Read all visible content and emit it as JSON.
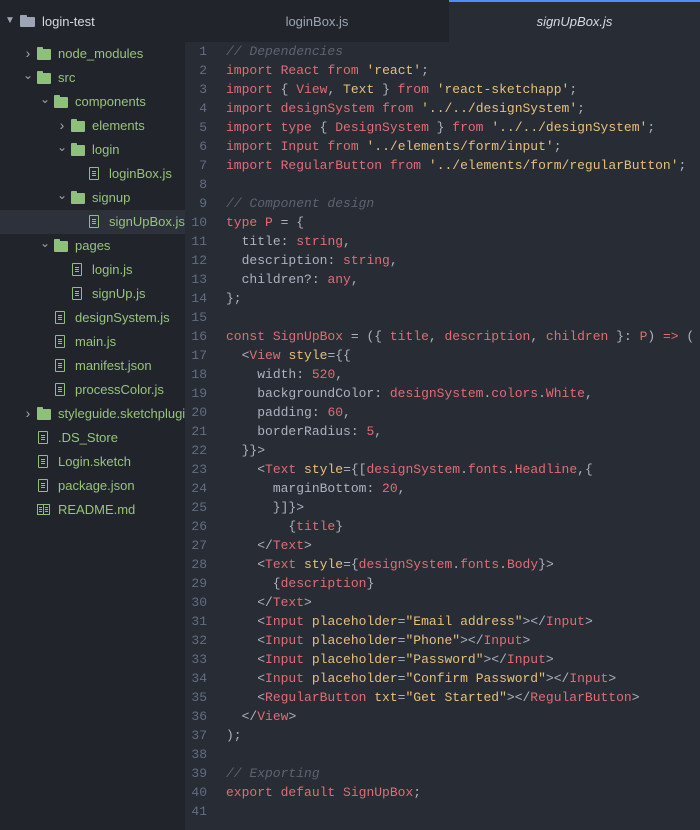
{
  "colors": {
    "sidebar_bg": "#21252b",
    "editor_bg": "#282c34",
    "tree_text": "#98c379",
    "active_tab_accent": "#528bff"
  },
  "project": {
    "name": "login-test",
    "expanded": true
  },
  "tree": [
    {
      "label": "node_modules",
      "kind": "folder",
      "depth": 1,
      "expanded": false
    },
    {
      "label": "src",
      "kind": "folder",
      "depth": 1,
      "expanded": true
    },
    {
      "label": "components",
      "kind": "folder",
      "depth": 2,
      "expanded": true
    },
    {
      "label": "elements",
      "kind": "folder",
      "depth": 3,
      "expanded": false
    },
    {
      "label": "login",
      "kind": "folder",
      "depth": 3,
      "expanded": true
    },
    {
      "label": "loginBox.js",
      "kind": "file",
      "depth": 4
    },
    {
      "label": "signup",
      "kind": "folder",
      "depth": 3,
      "expanded": true
    },
    {
      "label": "signUpBox.js",
      "kind": "file",
      "depth": 4,
      "selected": true
    },
    {
      "label": "pages",
      "kind": "folder",
      "depth": 2,
      "expanded": true
    },
    {
      "label": "login.js",
      "kind": "file",
      "depth": 3
    },
    {
      "label": "signUp.js",
      "kind": "file",
      "depth": 3
    },
    {
      "label": "designSystem.js",
      "kind": "file",
      "depth": 2
    },
    {
      "label": "main.js",
      "kind": "file",
      "depth": 2
    },
    {
      "label": "manifest.json",
      "kind": "file",
      "depth": 2
    },
    {
      "label": "processColor.js",
      "kind": "file",
      "depth": 2
    },
    {
      "label": "styleguide.sketchplugi",
      "kind": "folder",
      "depth": 1,
      "expanded": false
    },
    {
      "label": ".DS_Store",
      "kind": "file",
      "depth": 1
    },
    {
      "label": "Login.sketch",
      "kind": "file",
      "depth": 1
    },
    {
      "label": "package.json",
      "kind": "file",
      "depth": 1
    },
    {
      "label": "README.md",
      "kind": "book",
      "depth": 1
    }
  ],
  "tabs": [
    {
      "label": "loginBox.js",
      "active": false
    },
    {
      "label": "signUpBox.js",
      "active": true
    }
  ],
  "code": [
    {
      "n": "1",
      "t": [
        [
          "cm",
          "// Dependencies"
        ]
      ]
    },
    {
      "n": "2",
      "t": [
        [
          "kw",
          "import"
        ],
        [
          "txt",
          " "
        ],
        [
          "id",
          "React"
        ],
        [
          "txt",
          " "
        ],
        [
          "kw",
          "from"
        ],
        [
          "txt",
          " "
        ],
        [
          "str",
          "'react'"
        ],
        [
          "txt",
          ";"
        ]
      ]
    },
    {
      "n": "3",
      "t": [
        [
          "kw",
          "import"
        ],
        [
          "txt",
          " { "
        ],
        [
          "id",
          "View"
        ],
        [
          "txt",
          ", "
        ],
        [
          "cls",
          "Text"
        ],
        [
          "txt",
          " } "
        ],
        [
          "kw",
          "from"
        ],
        [
          "txt",
          " "
        ],
        [
          "str",
          "'react-sketchapp'"
        ],
        [
          "txt",
          ";"
        ]
      ]
    },
    {
      "n": "4",
      "t": [
        [
          "kw",
          "import"
        ],
        [
          "txt",
          " "
        ],
        [
          "id",
          "designSystem"
        ],
        [
          "txt",
          " "
        ],
        [
          "kw",
          "from"
        ],
        [
          "txt",
          " "
        ],
        [
          "str",
          "'../../designSystem'"
        ],
        [
          "txt",
          ";"
        ]
      ]
    },
    {
      "n": "5",
      "t": [
        [
          "kw",
          "import"
        ],
        [
          "txt",
          " "
        ],
        [
          "kw",
          "type"
        ],
        [
          "txt",
          " { "
        ],
        [
          "id",
          "DesignSystem"
        ],
        [
          "txt",
          " } "
        ],
        [
          "kw",
          "from"
        ],
        [
          "txt",
          " "
        ],
        [
          "str",
          "'../../designSystem'"
        ],
        [
          "txt",
          ";"
        ]
      ]
    },
    {
      "n": "6",
      "t": [
        [
          "kw",
          "import"
        ],
        [
          "txt",
          " "
        ],
        [
          "id",
          "Input"
        ],
        [
          "txt",
          " "
        ],
        [
          "kw",
          "from"
        ],
        [
          "txt",
          " "
        ],
        [
          "str",
          "'../elements/form/input'"
        ],
        [
          "txt",
          ";"
        ]
      ]
    },
    {
      "n": "7",
      "t": [
        [
          "kw",
          "import"
        ],
        [
          "txt",
          " "
        ],
        [
          "id",
          "RegularButton"
        ],
        [
          "txt",
          " "
        ],
        [
          "kw",
          "from"
        ],
        [
          "txt",
          " "
        ],
        [
          "str",
          "'../elements/form/regularButton'"
        ],
        [
          "txt",
          ";"
        ]
      ]
    },
    {
      "n": "8",
      "t": []
    },
    {
      "n": "9",
      "t": [
        [
          "cm",
          "// Component design"
        ]
      ]
    },
    {
      "n": "10",
      "t": [
        [
          "kw",
          "type"
        ],
        [
          "txt",
          " "
        ],
        [
          "id",
          "P"
        ],
        [
          "txt",
          " = {"
        ]
      ]
    },
    {
      "n": "11",
      "t": [
        [
          "txt",
          "  "
        ],
        [
          "pr",
          "title"
        ],
        [
          "txt",
          ": "
        ],
        [
          "id",
          "string"
        ],
        [
          "txt",
          ","
        ]
      ]
    },
    {
      "n": "12",
      "t": [
        [
          "txt",
          "  "
        ],
        [
          "pr",
          "description"
        ],
        [
          "txt",
          ": "
        ],
        [
          "id",
          "string"
        ],
        [
          "txt",
          ","
        ]
      ]
    },
    {
      "n": "13",
      "t": [
        [
          "txt",
          "  "
        ],
        [
          "pr",
          "children?"
        ],
        [
          "txt",
          ": "
        ],
        [
          "id",
          "any"
        ],
        [
          "txt",
          ","
        ]
      ]
    },
    {
      "n": "14",
      "t": [
        [
          "txt",
          "};"
        ]
      ]
    },
    {
      "n": "15",
      "t": []
    },
    {
      "n": "16",
      "t": [
        [
          "kw",
          "const"
        ],
        [
          "txt",
          " "
        ],
        [
          "id",
          "SignUpBox"
        ],
        [
          "txt",
          " = ({ "
        ],
        [
          "id",
          "title"
        ],
        [
          "txt",
          ", "
        ],
        [
          "id",
          "description"
        ],
        [
          "txt",
          ", "
        ],
        [
          "id",
          "children"
        ],
        [
          "txt",
          " }: "
        ],
        [
          "id",
          "P"
        ],
        [
          "txt",
          ") "
        ],
        [
          "kw",
          "=>"
        ],
        [
          "txt",
          " ("
        ]
      ]
    },
    {
      "n": "17",
      "t": [
        [
          "txt",
          "  <"
        ],
        [
          "tag",
          "View"
        ],
        [
          "txt",
          " "
        ],
        [
          "attr",
          "style"
        ],
        [
          "txt",
          "={{"
        ]
      ]
    },
    {
      "n": "18",
      "t": [
        [
          "txt",
          "    "
        ],
        [
          "pr",
          "width"
        ],
        [
          "txt",
          ": "
        ],
        [
          "id",
          "520"
        ],
        [
          "txt",
          ","
        ]
      ]
    },
    {
      "n": "19",
      "t": [
        [
          "txt",
          "    "
        ],
        [
          "pr",
          "backgroundColor"
        ],
        [
          "txt",
          ": "
        ],
        [
          "id",
          "designSystem"
        ],
        [
          "txt",
          "."
        ],
        [
          "id",
          "colors"
        ],
        [
          "txt",
          "."
        ],
        [
          "id",
          "White"
        ],
        [
          "txt",
          ","
        ]
      ]
    },
    {
      "n": "20",
      "t": [
        [
          "txt",
          "    "
        ],
        [
          "pr",
          "padding"
        ],
        [
          "txt",
          ": "
        ],
        [
          "id",
          "60"
        ],
        [
          "txt",
          ","
        ]
      ]
    },
    {
      "n": "21",
      "t": [
        [
          "txt",
          "    "
        ],
        [
          "pr",
          "borderRadius"
        ],
        [
          "txt",
          ": "
        ],
        [
          "id",
          "5"
        ],
        [
          "txt",
          ","
        ]
      ]
    },
    {
      "n": "22",
      "t": [
        [
          "txt",
          "  }}>"
        ]
      ]
    },
    {
      "n": "23",
      "t": [
        [
          "txt",
          "    <"
        ],
        [
          "tag",
          "Text"
        ],
        [
          "txt",
          " "
        ],
        [
          "attr",
          "style"
        ],
        [
          "txt",
          "={["
        ],
        [
          "id",
          "designSystem"
        ],
        [
          "txt",
          "."
        ],
        [
          "id",
          "fonts"
        ],
        [
          "txt",
          "."
        ],
        [
          "id",
          "Headline"
        ],
        [
          "txt",
          ",{"
        ]
      ]
    },
    {
      "n": "24",
      "t": [
        [
          "txt",
          "      "
        ],
        [
          "pr",
          "marginBottom"
        ],
        [
          "txt",
          ": "
        ],
        [
          "id",
          "20"
        ],
        [
          "txt",
          ","
        ]
      ]
    },
    {
      "n": "25",
      "t": [
        [
          "txt",
          "      }]}>"
        ]
      ]
    },
    {
      "n": "26",
      "t": [
        [
          "txt",
          "        {"
        ],
        [
          "id",
          "title"
        ],
        [
          "txt",
          "}"
        ]
      ]
    },
    {
      "n": "27",
      "t": [
        [
          "txt",
          "    </"
        ],
        [
          "tag",
          "Text"
        ],
        [
          "txt",
          ">"
        ]
      ]
    },
    {
      "n": "28",
      "t": [
        [
          "txt",
          "    <"
        ],
        [
          "tag",
          "Text"
        ],
        [
          "txt",
          " "
        ],
        [
          "attr",
          "style"
        ],
        [
          "txt",
          "={"
        ],
        [
          "id",
          "designSystem"
        ],
        [
          "txt",
          "."
        ],
        [
          "id",
          "fonts"
        ],
        [
          "txt",
          "."
        ],
        [
          "id",
          "Body"
        ],
        [
          "txt",
          "}>"
        ]
      ]
    },
    {
      "n": "29",
      "t": [
        [
          "txt",
          "      {"
        ],
        [
          "id",
          "description"
        ],
        [
          "txt",
          "}"
        ]
      ]
    },
    {
      "n": "30",
      "t": [
        [
          "txt",
          "    </"
        ],
        [
          "tag",
          "Text"
        ],
        [
          "txt",
          ">"
        ]
      ]
    },
    {
      "n": "31",
      "t": [
        [
          "txt",
          "    <"
        ],
        [
          "tag",
          "Input"
        ],
        [
          "txt",
          " "
        ],
        [
          "attr",
          "placeholder"
        ],
        [
          "txt",
          "="
        ],
        [
          "str",
          "\"Email address\""
        ],
        [
          "txt",
          "></"
        ],
        [
          "tag",
          "Input"
        ],
        [
          "txt",
          ">"
        ]
      ]
    },
    {
      "n": "32",
      "t": [
        [
          "txt",
          "    <"
        ],
        [
          "tag",
          "Input"
        ],
        [
          "txt",
          " "
        ],
        [
          "attr",
          "placeholder"
        ],
        [
          "txt",
          "="
        ],
        [
          "str",
          "\"Phone\""
        ],
        [
          "txt",
          "></"
        ],
        [
          "tag",
          "Input"
        ],
        [
          "txt",
          ">"
        ]
      ]
    },
    {
      "n": "33",
      "t": [
        [
          "txt",
          "    <"
        ],
        [
          "tag",
          "Input"
        ],
        [
          "txt",
          " "
        ],
        [
          "attr",
          "placeholder"
        ],
        [
          "txt",
          "="
        ],
        [
          "str",
          "\"Password\""
        ],
        [
          "txt",
          "></"
        ],
        [
          "tag",
          "Input"
        ],
        [
          "txt",
          ">"
        ]
      ]
    },
    {
      "n": "34",
      "t": [
        [
          "txt",
          "    <"
        ],
        [
          "tag",
          "Input"
        ],
        [
          "txt",
          " "
        ],
        [
          "attr",
          "placeholder"
        ],
        [
          "txt",
          "="
        ],
        [
          "str",
          "\"Confirm Password\""
        ],
        [
          "txt",
          "></"
        ],
        [
          "tag",
          "Input"
        ],
        [
          "txt",
          ">"
        ]
      ]
    },
    {
      "n": "35",
      "t": [
        [
          "txt",
          "    <"
        ],
        [
          "tag",
          "RegularButton"
        ],
        [
          "txt",
          " "
        ],
        [
          "attr",
          "txt"
        ],
        [
          "txt",
          "="
        ],
        [
          "str",
          "\"Get Started\""
        ],
        [
          "txt",
          "></"
        ],
        [
          "tag",
          "RegularButton"
        ],
        [
          "txt",
          ">"
        ]
      ]
    },
    {
      "n": "36",
      "t": [
        [
          "txt",
          "  </"
        ],
        [
          "tag",
          "View"
        ],
        [
          "txt",
          ">"
        ]
      ]
    },
    {
      "n": "37",
      "t": [
        [
          "txt",
          ");"
        ]
      ]
    },
    {
      "n": "38",
      "t": []
    },
    {
      "n": "39",
      "t": [
        [
          "cm",
          "// Exporting"
        ]
      ]
    },
    {
      "n": "40",
      "t": [
        [
          "kw",
          "export"
        ],
        [
          "txt",
          " "
        ],
        [
          "kw",
          "default"
        ],
        [
          "txt",
          " "
        ],
        [
          "id",
          "SignUpBox"
        ],
        [
          "txt",
          ";"
        ]
      ]
    },
    {
      "n": "41",
      "t": []
    }
  ]
}
